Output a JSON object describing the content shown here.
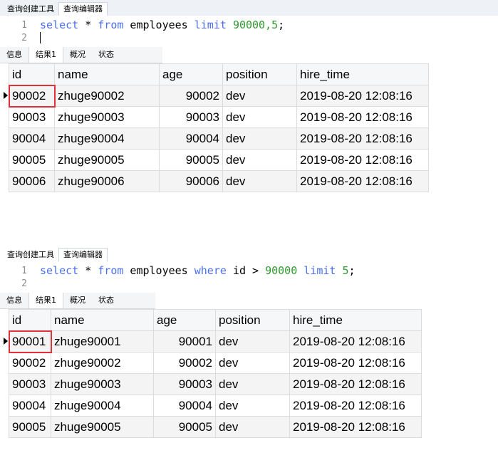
{
  "panels": [
    {
      "tabs": [
        "查询创建工具",
        "查询编辑器"
      ],
      "editor": {
        "lines": [
          {
            "n": "1",
            "t1": "select",
            "t2": " * ",
            "t3": "from",
            "t4": " employees ",
            "t5": "limit",
            "t6": " ",
            "t7": "90000,5",
            "t8": ";"
          },
          {
            "n": "2"
          }
        ]
      },
      "result_tabs": [
        "信息",
        "结果1",
        "概况",
        "状态"
      ],
      "columns": [
        "id",
        "name",
        "age",
        "position",
        "hire_time"
      ],
      "rows": [
        [
          "90002",
          "zhuge90002",
          "90002",
          "dev",
          "2019-08-20 12:08:16"
        ],
        [
          "90003",
          "zhuge90003",
          "90003",
          "dev",
          "2019-08-20 12:08:16"
        ],
        [
          "90004",
          "zhuge90004",
          "90004",
          "dev",
          "2019-08-20 12:08:16"
        ],
        [
          "90005",
          "zhuge90005",
          "90005",
          "dev",
          "2019-08-20 12:08:16"
        ],
        [
          "90006",
          "zhuge90006",
          "90006",
          "dev",
          "2019-08-20 12:08:16"
        ]
      ]
    },
    {
      "tabs": [
        "查询创建工具",
        "查询编辑器"
      ],
      "editor": {
        "lines": [
          {
            "n": "1",
            "t1": "select",
            "t2": " * ",
            "t3": "from",
            "t4": " employees ",
            "t5": "where",
            "t6": " id > ",
            "t7": "90000",
            "t8": " limit ",
            "t9": "5",
            "t10": ";"
          },
          {
            "n": "2"
          }
        ]
      },
      "result_tabs": [
        "信息",
        "结果1",
        "概况",
        "状态"
      ],
      "columns": [
        "id",
        "name",
        "age",
        "position",
        "hire_time"
      ],
      "rows": [
        [
          "90001",
          "zhuge90001",
          "90001",
          "dev",
          "2019-08-20 12:08:16"
        ],
        [
          "90002",
          "zhuge90002",
          "90002",
          "dev",
          "2019-08-20 12:08:16"
        ],
        [
          "90003",
          "zhuge90003",
          "90003",
          "dev",
          "2019-08-20 12:08:16"
        ],
        [
          "90004",
          "zhuge90004",
          "90004",
          "dev",
          "2019-08-20 12:08:16"
        ],
        [
          "90005",
          "zhuge90005",
          "90005",
          "dev",
          "2019-08-20 12:08:16"
        ]
      ]
    }
  ],
  "colors": {
    "keyword": "#4a6ff0",
    "number": "#2f9a2f",
    "highlight": "#e0303a"
  }
}
